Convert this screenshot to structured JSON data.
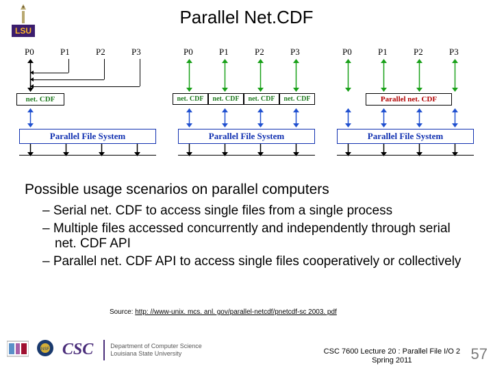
{
  "header": {
    "title": "Parallel Net.CDF",
    "logoText": "LSU"
  },
  "diagram": {
    "procs": [
      "P0",
      "P1",
      "P2",
      "P3"
    ],
    "layers": {
      "netcdf": "net. CDF",
      "pnetcdf": "Parallel net. CDF",
      "pfs": "Parallel File System"
    },
    "panels": [
      {
        "boxes": [
          {
            "type": "netcdf"
          }
        ],
        "autoPlabels": false
      },
      {
        "boxes": [
          {
            "type": "netcdf"
          },
          {
            "type": "netcdf"
          },
          {
            "type": "netcdf"
          },
          {
            "type": "netcdf"
          }
        ]
      },
      {
        "boxes": [
          {
            "type": "pnetcdf"
          }
        ]
      }
    ]
  },
  "subheading": "Possible usage scenarios on parallel computers",
  "bullets": [
    "Serial net. CDF to access single files from a single process",
    "Multiple files accessed concurrently and independently through serial net. CDF API",
    "Parallel net. CDF API to access single files cooperatively or collectively"
  ],
  "source": {
    "prefix": "Source: ",
    "url": "http: //www-unix. mcs. anl. gov/parallel-netcdf/pnetcdf-sc 2003. pdf"
  },
  "footer": {
    "line1": "CSC 7600 Lecture 20 : Parallel File I/O 2",
    "line2": "Spring 2011",
    "pagenum": "57",
    "csc": "CSC",
    "dept": "Department of Computer Science",
    "univ": "Louisiana State University"
  }
}
